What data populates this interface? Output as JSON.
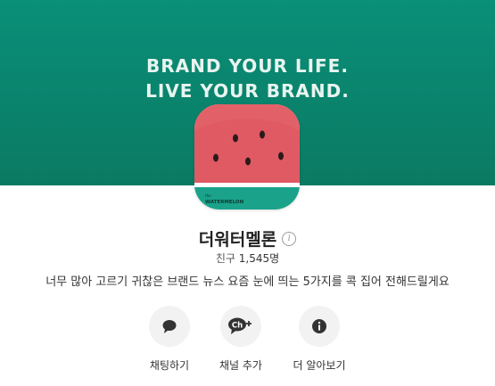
{
  "banner": {
    "line1": "BRAND YOUR LIFE.",
    "line2": "LIVE YOUR BRAND."
  },
  "avatar": {
    "logo_small": "the",
    "logo_text": "WATERMELON"
  },
  "profile": {
    "name": "더워터멜론",
    "friends_label": "친구",
    "friends_count": "1,545명",
    "description": "너무 많아 고르기 귀찮은 브랜드 뉴스 요즘 눈에 띄는 5가지를 콕 집어 전해드릴게요"
  },
  "actions": [
    {
      "label": "채팅하기",
      "icon": "chat-bubble-icon"
    },
    {
      "label": "채널 추가",
      "icon": "channel-add-icon"
    },
    {
      "label": "더 알아보기",
      "icon": "info-icon"
    }
  ],
  "colors": {
    "banner": "#0a8f78",
    "watermelon_red": "#e05a63",
    "rind": "#1aa38a",
    "action_bg": "#f2f2f2"
  }
}
